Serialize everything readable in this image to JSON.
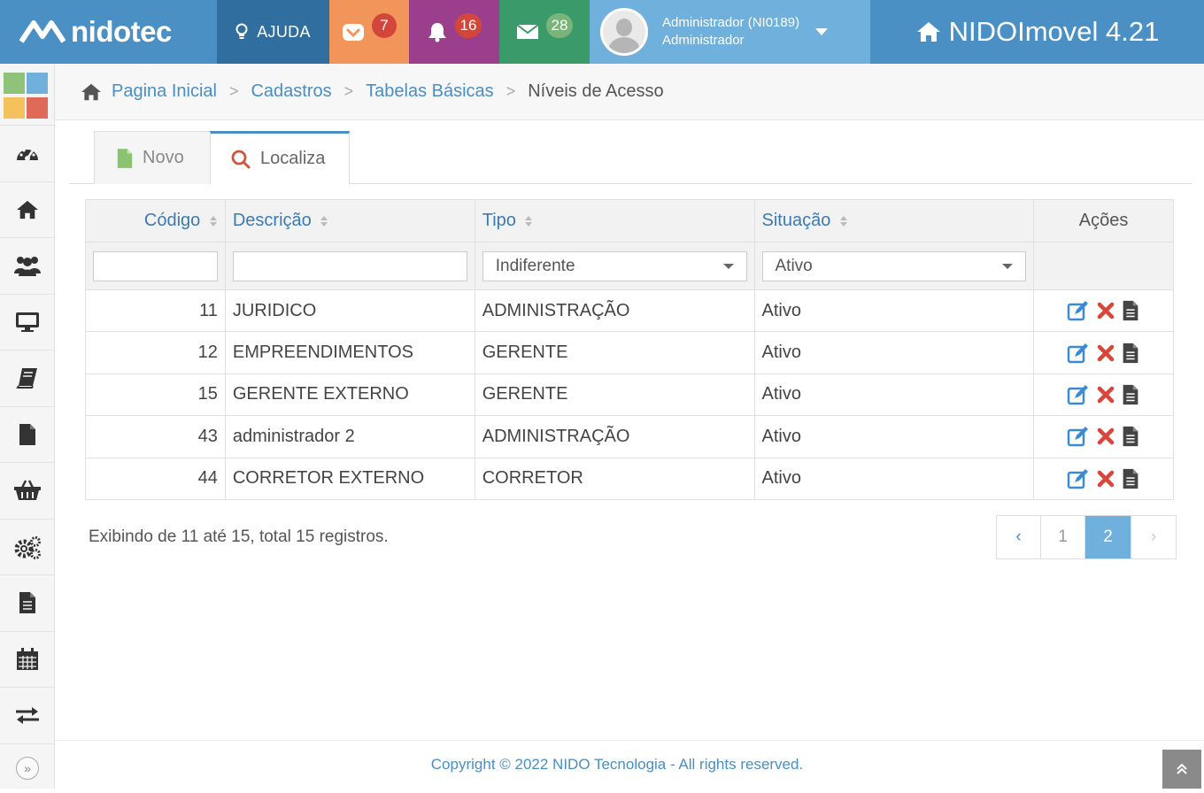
{
  "brand": {
    "logo_text": "nidotec",
    "product": "NIDOImovel 4.21"
  },
  "topbar": {
    "help_label": "AJUDA",
    "tasks_count": "7",
    "alerts_count": "16",
    "messages_count": "28",
    "user_name": "Administrador (NI0189)",
    "user_role": "Administrador",
    "colors": {
      "bar": "#4a90c4",
      "help": "#2f6e9e",
      "tasks": "#f2955a",
      "alerts": "#9b3f8c",
      "messages": "#3b9a6a",
      "user": "#6fb0dc"
    }
  },
  "sidebar": {
    "icons": [
      "dashboard-icon",
      "home-icon",
      "users-icon",
      "monitor-icon",
      "book-icon",
      "file-icon",
      "basket-icon",
      "cogs-icon",
      "document-icon",
      "calendar-icon",
      "exchange-icon"
    ]
  },
  "breadcrumb": {
    "items": [
      "Pagina Inicial",
      "Cadastros",
      "Tabelas Básicas"
    ],
    "current": "Níveis de Acesso"
  },
  "tabs": {
    "new_label": "Novo",
    "find_label": "Localiza"
  },
  "table": {
    "columns": [
      "Código",
      "Descrição",
      "Tipo",
      "Situação",
      "Ações"
    ],
    "filters": {
      "tipo": "Indiferente",
      "situacao": "Ativo"
    },
    "rows": [
      {
        "codigo": "11",
        "descricao": "JURIDICO",
        "tipo": "ADMINISTRAÇÃO",
        "situacao": "Ativo"
      },
      {
        "codigo": "12",
        "descricao": "EMPREENDIMENTOS",
        "tipo": "GERENTE",
        "situacao": "Ativo"
      },
      {
        "codigo": "15",
        "descricao": "GERENTE EXTERNO",
        "tipo": "GERENTE",
        "situacao": "Ativo"
      },
      {
        "codigo": "43",
        "descricao": "administrador 2",
        "tipo": "ADMINISTRAÇÃO",
        "situacao": "Ativo"
      },
      {
        "codigo": "44",
        "descricao": "CORRETOR EXTERNO",
        "tipo": "CORRETOR",
        "situacao": "Ativo"
      }
    ]
  },
  "summary": "Exibindo de 11 até 15, total 15 registros.",
  "pager": {
    "prev": "‹",
    "pages": [
      "1",
      "2"
    ],
    "current": "2",
    "next": "›"
  },
  "footer": {
    "copyright": "Copyright © 2022 NIDO Tecnologia - All rights reserved."
  }
}
